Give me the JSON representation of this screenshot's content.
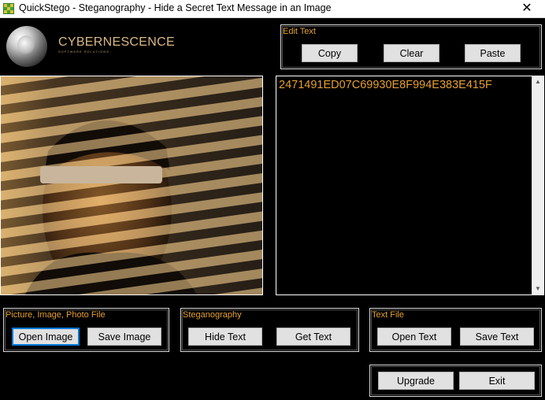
{
  "window": {
    "title": "QuickStego - Steganography - Hide a Secret Text Message in an Image",
    "close_glyph": "✕"
  },
  "brand": {
    "name": "CYBERNESCENCE",
    "tagline": "SOFTWARE SOLUTIONS"
  },
  "edit_text": {
    "label": "Edit Text",
    "copy": "Copy",
    "clear": "Clear",
    "paste": "Paste"
  },
  "message": {
    "text": "2471491ED07C69930E8F994E383E415F"
  },
  "picture": {
    "label": "Picture, Image, Photo File",
    "open": "Open Image",
    "save": "Save Image"
  },
  "steganography": {
    "label": "Steganography",
    "hide": "Hide Text",
    "get": "Get Text"
  },
  "text_file": {
    "label": "Text File",
    "open": "Open Text",
    "save": "Save Text"
  },
  "footer": {
    "upgrade": "Upgrade",
    "exit": "Exit"
  },
  "colors": {
    "accent": "#e6a02e",
    "brand": "#d9b982",
    "background": "#000000",
    "focus": "#0078d7"
  },
  "icons": {
    "app": "quickstego-app-icon",
    "close": "close-icon",
    "logo": "cybernescence-logo",
    "scroll_up": "scroll-up-arrow-icon",
    "scroll_down": "scroll-down-arrow-icon"
  }
}
